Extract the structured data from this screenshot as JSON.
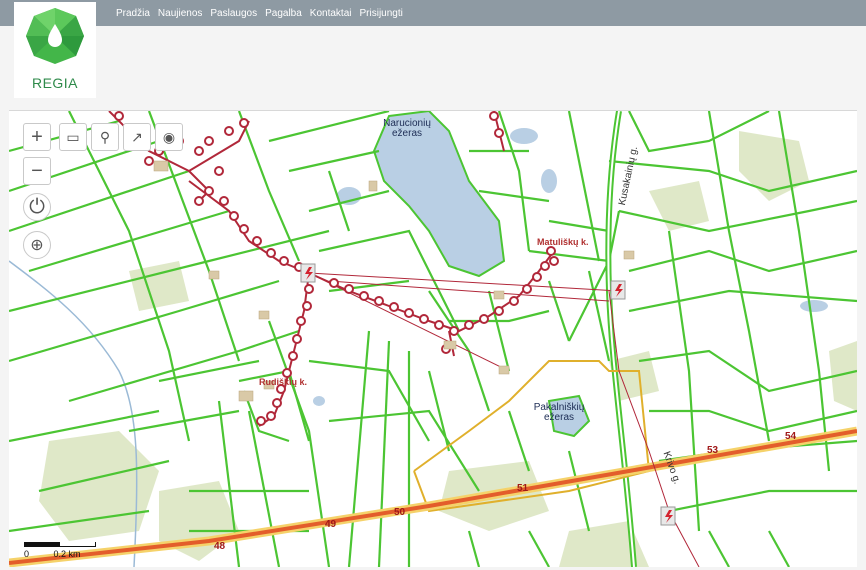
{
  "nav": {
    "items": [
      "Pradžia",
      "Naujienos",
      "Paslaugos",
      "Pagalba",
      "Kontaktai",
      "Prisijungti"
    ]
  },
  "logo": {
    "text": "REGIA",
    "color": "#43b649"
  },
  "map_labels": {
    "lake1": "Narucionių ežeras",
    "lake2": "Pakalniškių ežeras",
    "village1": "Matuliškų k.",
    "village2": "Rudiškių k.",
    "road_side": "Kusakainių g.",
    "road_side2": "Krivo g."
  },
  "road_numbers": [
    "48",
    "49",
    "50",
    "51",
    "53",
    "54"
  ],
  "scale": {
    "zero": "0",
    "dist": "0.2 km"
  },
  "colors": {
    "parcel": "#4cc533",
    "lake": "#b9cfe4",
    "road": "#e35d2b",
    "powerline": "#b1283a",
    "forest": "#dfe8c8"
  },
  "toolbar_icons": [
    "zoom-in-icon",
    "ruler-icon",
    "marker-icon",
    "share-icon",
    "target-icon"
  ],
  "side_icons": [
    "zoom-out-icon",
    "power-icon",
    "locate-icon"
  ]
}
